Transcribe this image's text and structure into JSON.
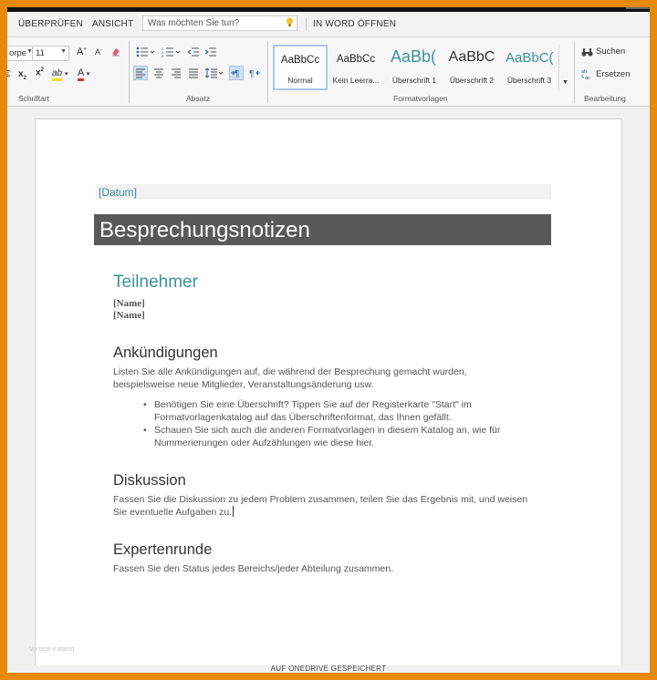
{
  "ribbon_tabs": [
    "ÜBERPRÜFEN",
    "ANSICHT"
  ],
  "tell_me": {
    "placeholder": "Was möchten Sie tun?"
  },
  "open_in_word": "IN WORD ÖFFNEN",
  "font": {
    "name": "orpe",
    "size": "11"
  },
  "groups": {
    "font": "Schriftart",
    "paragraph": "Absatz",
    "styles": "Formatvorlagen",
    "editing": "Bearbeitung"
  },
  "styles": [
    {
      "preview": "AaBbCc",
      "caption": "Normal"
    },
    {
      "preview": "AaBbCc",
      "caption": "Kein Leerra..."
    },
    {
      "preview": "AaBb(",
      "caption": "Überschrift 1"
    },
    {
      "preview": "AaBbC",
      "caption": "Überschrift 2"
    },
    {
      "preview": "AaBbC(",
      "caption": "Überschrift 3"
    }
  ],
  "editing": {
    "find": "Suchen",
    "replace": "Ersetzen"
  },
  "document": {
    "date": "[Datum]",
    "title": "Besprechungsnotizen",
    "participants_heading": "Teilnehmer",
    "names": [
      "[Name]",
      "[Name]"
    ],
    "announcements_heading": "Ankündigungen",
    "announcements_body": [
      "Listen Sie alle Ankündigungen auf, die während der Besprechung gemacht wurden,",
      "beispielsweise neue Mitglieder, Veranstaltungsänderung usw."
    ],
    "bullets": [
      [
        "Benötigen Sie eine Überschrift? Tippen Sie auf der Registerkarte \"Start\" im",
        "Formatvorlagenkatalog auf das Überschriftenformat, das Ihnen gefällt."
      ],
      [
        "Schauen Sie sich auch die anderen Formatvorlagen in diesem Katalog an, wie für",
        "Nummerierungen oder Aufzählungen wie diese hier."
      ]
    ],
    "discussion_heading": "Diskussion",
    "discussion_body": [
      "Fassen Sie die Diskussion zu jedem Problem zusammen, teilen Sie das Ergebnis mit, und weisen",
      "Sie eventuelle Aufgaben zu."
    ],
    "experts_heading": "Expertenrunde",
    "experts_body": "Fassen Sie den Status jedes Bereichs/jeder Abteilung zusammen."
  },
  "watermark": "Vorlage Katalog",
  "status": "AUF ONEDRIVE GESPEICHERT"
}
